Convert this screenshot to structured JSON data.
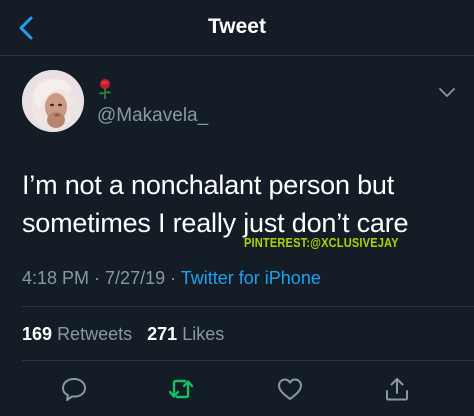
{
  "header": {
    "title": "Tweet",
    "back_icon": "chevron-left-icon"
  },
  "user": {
    "handle": "@Makavela_",
    "emoji": "rose-icon",
    "avatar": "profile-photo"
  },
  "tweet": {
    "text_line1": "I’m not a nonchalant person but",
    "text_line2": "sometimes I really just don’t care",
    "time": "4:18 PM",
    "sep1": " · ",
    "date": "7/27/19",
    "sep2": " · ",
    "source": "Twitter for iPhone"
  },
  "watermark": "PINTEREST:@XCLUSIVEJAY",
  "stats": {
    "retweets_count": "169",
    "retweets_label": "Retweets",
    "likes_count": "271",
    "likes_label": "Likes"
  },
  "actions": [
    "reply-icon",
    "retweet-icon",
    "like-icon",
    "share-icon"
  ],
  "colors": {
    "background": "#141d26",
    "accent": "#1da1f2",
    "secondary_text": "#8899a6",
    "retweet_green": "#17bf63",
    "watermark": "#a8d600"
  }
}
